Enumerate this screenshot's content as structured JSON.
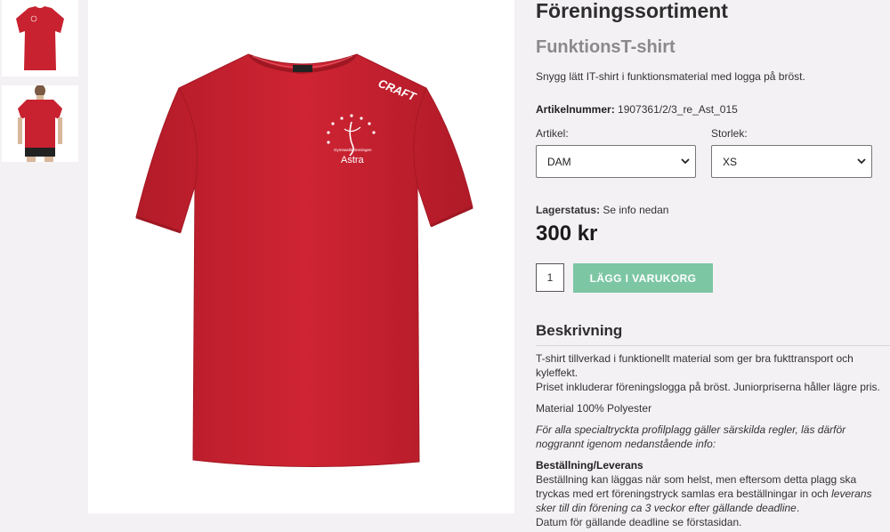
{
  "gallery": {
    "thumbnails": [
      {
        "label": "front",
        "selected": true
      },
      {
        "label": "back",
        "selected": false
      }
    ],
    "shirt_color": "#c8212f",
    "shirt_logo": {
      "brand": "CRAFT",
      "club_small": "Gymnastikföreningen",
      "club_name": "Astra"
    }
  },
  "product": {
    "category_title": "Föreningssortiment",
    "name": "FunktionsT-shirt",
    "short_description": "Snygg lätt IT-shirt i funktionsmaterial med logga på bröst.",
    "sku_label": "Artikelnummer:",
    "sku_value": "1907361/2/3_re_Ast_015",
    "artikel_label": "Artikel:",
    "artikel_value": "DAM",
    "storlek_label": "Storlek:",
    "storlek_value": "XS",
    "stock_label": "Lagerstatus:",
    "stock_value": "Se info nedan",
    "price": "300 kr",
    "quantity": "1",
    "add_to_cart": "LÄGG I VARUKORG"
  },
  "description": {
    "heading": "Beskrivning",
    "p1_line1": "T-shirt tillverkad i funktionellt material som ger bra fukttransport och kyleffekt.",
    "p1_line2": "Priset inkluderar föreningslogga på bröst. Juniorpriserna håller lägre pris.",
    "material": "Material 100% Polyester",
    "special_note": "För alla specialtryckta profilplagg gäller särskilda regler, läs därför noggrannt igenom nedanstående info:",
    "order_heading": "Beställning/Leverans",
    "order_text_a": "Beställning kan läggas när som helst, men eftersom detta plagg ska tryckas med ert föreningstryck samlas era beställningar in och ",
    "order_text_italic": "leverans sker till din förening ca 3 veckor efter gällande deadline",
    "order_text_b": ".",
    "order_text_c": "Datum för gällande deadline se förstasidan."
  },
  "colors": {
    "accent_button": "#7cc6a4",
    "background": "#f4f1f4"
  }
}
